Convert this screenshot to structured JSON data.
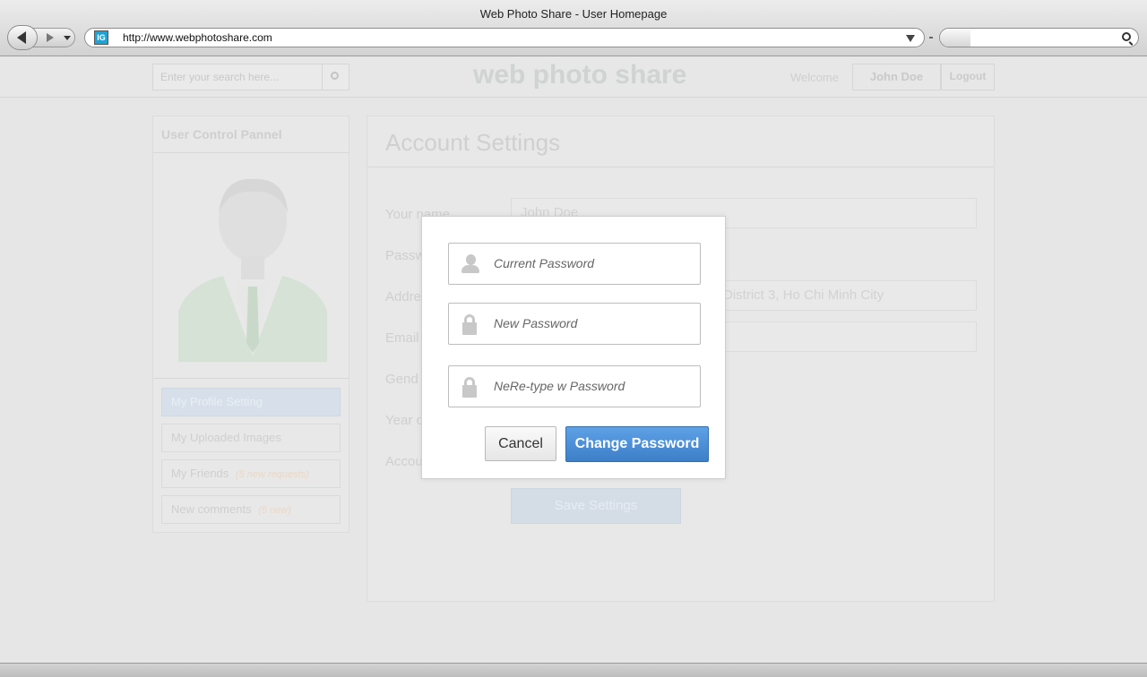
{
  "window": {
    "title": "Web Photo Share - User Homepage"
  },
  "browser": {
    "url": "http://www.webphotoshare.com",
    "site_icon_text": "IG"
  },
  "header": {
    "search_placeholder": "Enter your search here...",
    "logo": "web photo share",
    "welcome": "Welcome",
    "user_name": "John Doe",
    "logout": "Logout"
  },
  "sidebar": {
    "title": "User Control Pannel",
    "items": [
      {
        "label": "My Profile Setting",
        "note": ""
      },
      {
        "label": "My Uploaded Images",
        "note": ""
      },
      {
        "label": "My Friends",
        "note": "(5 new requests)"
      },
      {
        "label": "New comments",
        "note": "(5 new)"
      }
    ]
  },
  "settings": {
    "title": "Account Settings",
    "labels": {
      "name": "Your name",
      "password": "Passw",
      "address": "Addre",
      "email": "Email",
      "gender": "Gend",
      "year": "Year o",
      "account": "Accou"
    },
    "values": {
      "name": "John Doe",
      "address": "District 3, Ho Chi Minh City"
    },
    "save_label": "Save Settings"
  },
  "modal": {
    "current_placeholder": "Current Password",
    "new_placeholder": "New Password",
    "retype_placeholder": "NeRe-type w Password",
    "cancel_label": "Cancel",
    "change_label": "Change Password",
    "accent_color": "#4a8fd8"
  }
}
